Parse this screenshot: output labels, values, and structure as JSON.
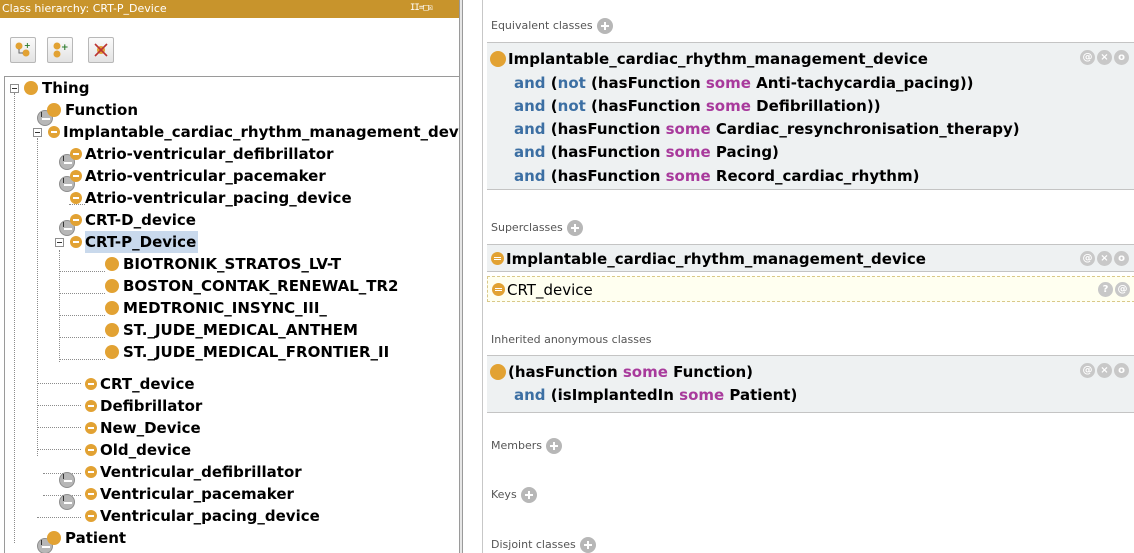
{
  "left_panel": {
    "title": "Class hierarchy: CRT-P_Device",
    "window_controls": "II=□☒",
    "toolbar": [
      {
        "name": "add-subclass-button",
        "icon": "add-subclass-icon"
      },
      {
        "name": "add-sibling-button",
        "icon": "add-sibling-icon"
      },
      {
        "name": "delete-class-button",
        "icon": "delete-class-icon"
      }
    ],
    "tree": [
      {
        "label": "Thing",
        "level": 0
      },
      {
        "label": "Function",
        "level": 1
      },
      {
        "label": "Implantable_cardiac_rhythm_management_device",
        "level": 1
      },
      {
        "label": "Atrio-ventricular_defibrillator",
        "level": 2
      },
      {
        "label": "Atrio-ventricular_pacemaker",
        "level": 2
      },
      {
        "label": "Atrio-ventricular_pacing_device",
        "level": 2
      },
      {
        "label": "CRT-D_device",
        "level": 2
      },
      {
        "label": "CRT-P_Device",
        "level": 2,
        "selected": true
      },
      {
        "label": "BIOTRONIK_STRATOS_LV-T",
        "level": 3
      },
      {
        "label": "BOSTON_CONTAK_RENEWAL_TR2",
        "level": 3
      },
      {
        "label": "MEDTRONIC_INSYNC_III_",
        "level": 3
      },
      {
        "label": "ST._JUDE_MEDICAL_ANTHEM",
        "level": 3
      },
      {
        "label": "ST._JUDE_MEDICAL_FRONTIER_II",
        "level": 3
      },
      {
        "label": "CRT_device",
        "level": 2
      },
      {
        "label": "Defibrillator",
        "level": 2
      },
      {
        "label": "New_Device",
        "level": 2
      },
      {
        "label": "Old_device",
        "level": 2
      },
      {
        "label": "Ventricular_defibrillator",
        "level": 2
      },
      {
        "label": "Ventricular_pacemaker",
        "level": 2
      },
      {
        "label": "Ventricular_pacing_device",
        "level": 2
      },
      {
        "label": "Patient",
        "level": 1
      }
    ]
  },
  "right_panel": {
    "sections": {
      "equivalent": "Equivalent classes",
      "superclasses": "Superclasses",
      "inherited": "Inherited anonymous classes",
      "members": "Members",
      "keys": "Keys",
      "disjoint": "Disjoint classes"
    },
    "equivalent_expr": {
      "head": "Implantable_cardiac_rhythm_management_device",
      "lines": [
        {
          "and": "and",
          "open": "(",
          "not": "not",
          "rest1": " (hasFunction ",
          "kw": "some",
          "rest2": " Anti-tachycardia_pacing))"
        },
        {
          "and": "and",
          "open": "(",
          "not": "not",
          "rest1": " (hasFunction ",
          "kw": "some",
          "rest2": " Defibrillation))"
        },
        {
          "and": "and",
          "rest1": " (hasFunction ",
          "kw": "some",
          "rest2": " Cardiac_resynchronisation_therapy)"
        },
        {
          "and": "and",
          "rest1": " (hasFunction ",
          "kw": "some",
          "rest2": " Pacing)"
        },
        {
          "and": "and",
          "rest1": " (hasFunction ",
          "kw": "some",
          "rest2": " Record_cardiac_rhythm)"
        }
      ]
    },
    "superclasses": [
      "Implantable_cardiac_rhythm_management_device",
      "CRT_device"
    ],
    "inherited": {
      "line1": {
        "pre": "(hasFunction ",
        "kw": "some",
        "post": " Function)"
      },
      "line2": {
        "and": "and",
        "pre": " (isImplantedIn ",
        "kw": "some",
        "post": " Patient)"
      }
    },
    "row_icons": {
      "annotate": "@",
      "remove": "×",
      "edit": "o",
      "explain": "?"
    }
  },
  "colors": {
    "title_bar": "#c8942c",
    "class_dot": "#e2a233",
    "keyword_and": "#3c6fa3",
    "keyword_some": "#a83a9c",
    "selection": "#c9d9ec"
  }
}
